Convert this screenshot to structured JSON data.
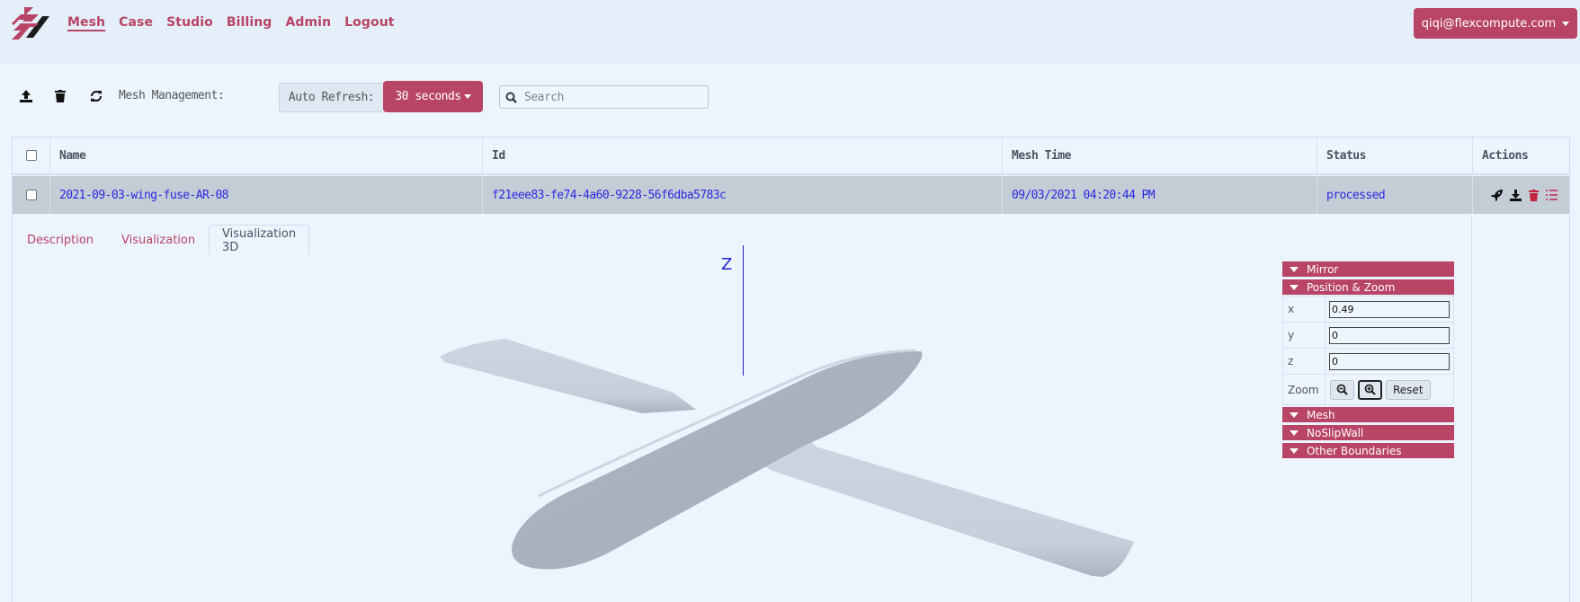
{
  "header": {
    "nav": [
      {
        "label": "Mesh",
        "active": true
      },
      {
        "label": "Case",
        "active": false
      },
      {
        "label": "Studio",
        "active": false
      },
      {
        "label": "Billing",
        "active": false
      },
      {
        "label": "Admin",
        "active": false
      },
      {
        "label": "Logout",
        "active": false
      }
    ],
    "user_email": "qiqi@flexcompute.com"
  },
  "toolbar": {
    "icons": [
      "upload-icon",
      "trash-icon",
      "refresh-icon"
    ],
    "title": "Mesh Management:",
    "auto_refresh_label": "Auto Refresh:",
    "auto_refresh_value": "30 seconds",
    "search_placeholder": "Search",
    "search_value": ""
  },
  "table": {
    "columns": [
      "Name",
      "Id",
      "Mesh Time",
      "Status",
      "Actions"
    ],
    "rows": [
      {
        "name": "2021-09-03-wing-fuse-AR-08",
        "id": "f21eee83-fe74-4a60-9228-56f6dba5783c",
        "mesh_time": "09/03/2021 04:20:44 PM",
        "status": "processed",
        "actions": [
          "launch-case-icon",
          "download-icon",
          "delete-icon",
          "details-list-icon"
        ]
      }
    ]
  },
  "detail": {
    "tabs": [
      {
        "label": "Description",
        "active": false
      },
      {
        "label": "Visualization",
        "active": false
      },
      {
        "label": "Visualization 3D",
        "active": true
      }
    ],
    "viewer": {
      "axis_label": "Z",
      "model": "wing-fuselage mesh"
    },
    "panel": {
      "sections": {
        "mirror": "Mirror",
        "position_zoom": "Position & Zoom",
        "mesh": "Mesh",
        "noslipwall": "NoSlipWall",
        "other_boundaries": "Other Boundaries"
      },
      "fields": {
        "x_label": "x",
        "x_value": "0.49",
        "y_label": "y",
        "y_value": "0",
        "z_label": "z",
        "z_value": "0",
        "zoom_label": "Zoom",
        "reset_label": "Reset"
      }
    }
  },
  "colors": {
    "brand": "#b84466",
    "link": "#2a2ae0",
    "background": "#ecf4fe",
    "row_selected": "#c4ccd6"
  }
}
